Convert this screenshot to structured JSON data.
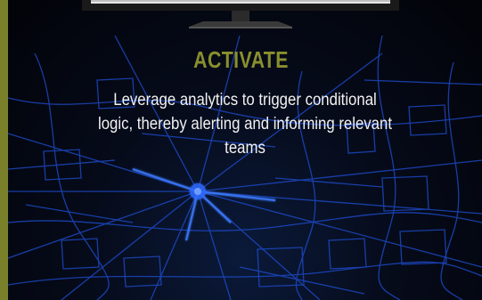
{
  "heading": {
    "title": "ACTIVATE"
  },
  "body": {
    "description": "Leverage analytics to trigger conditional logic, thereby alerting and informing relevant teams"
  },
  "colors": {
    "accent": "#7a7f2a",
    "title": "#8a8f2e",
    "text": "#f2f2f2",
    "map_lines": "#2a6bff",
    "background": "#050a18"
  },
  "icons": {
    "monitor": "monitor-icon",
    "map": "city-street-map"
  }
}
